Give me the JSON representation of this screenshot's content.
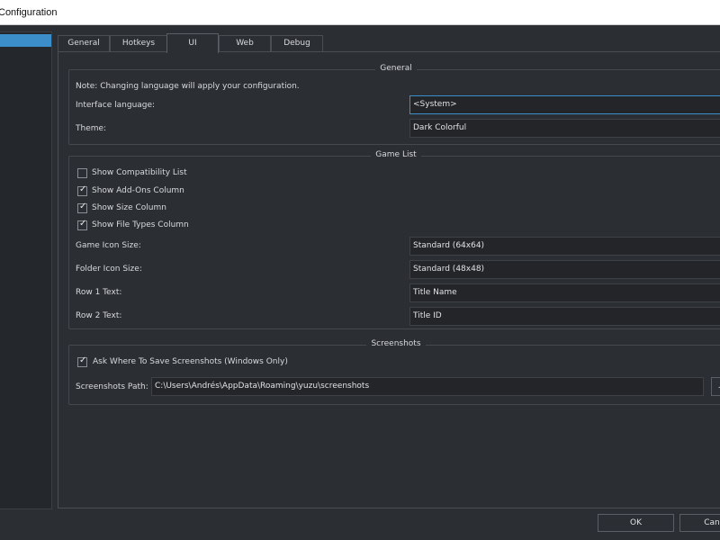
{
  "window": {
    "title": "Configuration"
  },
  "tabs": [
    {
      "label": "General"
    },
    {
      "label": "Hotkeys"
    },
    {
      "label": "UI"
    },
    {
      "label": "Web"
    },
    {
      "label": "Debug"
    }
  ],
  "general": {
    "title": "General",
    "note": "Note: Changing language will apply your configuration.",
    "language_label": "Interface language:",
    "language_value": "<System>",
    "theme_label": "Theme:",
    "theme_value": "Dark Colorful"
  },
  "game_list": {
    "title": "Game List",
    "checkboxes": [
      {
        "label": "Show Compatibility List",
        "checked": false
      },
      {
        "label": "Show Add-Ons Column",
        "checked": true
      },
      {
        "label": "Show Size Column",
        "checked": true
      },
      {
        "label": "Show File Types Column",
        "checked": true
      }
    ],
    "game_icon_label": "Game Icon Size:",
    "game_icon_value": "Standard (64x64)",
    "folder_icon_label": "Folder Icon Size:",
    "folder_icon_value": "Standard (48x48)",
    "row1_label": "Row 1 Text:",
    "row1_value": "Title Name",
    "row2_label": "Row 2 Text:",
    "row2_value": "Title ID"
  },
  "screenshots": {
    "title": "Screenshots",
    "ask_label": "Ask Where To Save Screenshots (Windows Only)",
    "ask_checked": true,
    "path_label": "Screenshots Path:",
    "path_value": "C:\\Users\\Andrés\\AppData\\Roaming\\yuzu\\screenshots",
    "browse_label": "..."
  },
  "buttons": {
    "ok": "OK",
    "cancel": "Cancel"
  },
  "colors": {
    "accent": "#3b8ec9",
    "background": "#2b2e33"
  }
}
